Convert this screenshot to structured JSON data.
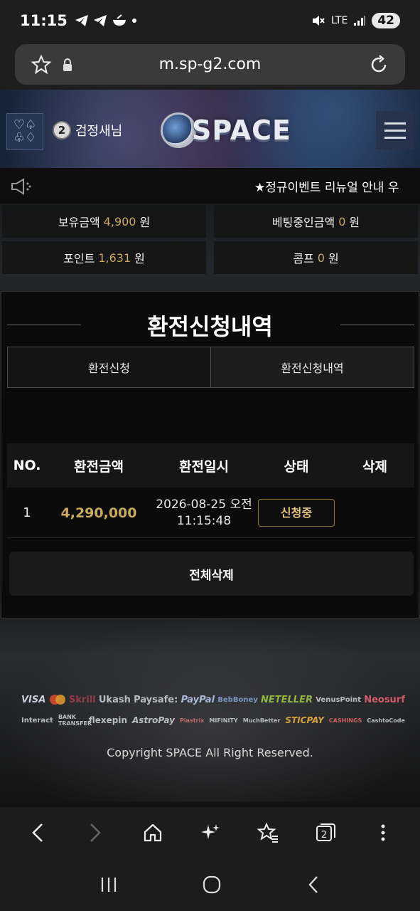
{
  "status_bar": {
    "time": "11:15",
    "network": "LTE",
    "battery": "42"
  },
  "browser": {
    "url": "m.sp-g2.com"
  },
  "header": {
    "user_level": "2",
    "username": "검정새님",
    "logo_text": "SPACE"
  },
  "notice": {
    "text": "★정규이벤트 리뉴얼 안내 우"
  },
  "balances": {
    "holdings_label": "보유금액",
    "holdings_value": "4,900",
    "holdings_unit": "원",
    "betting_label": "베팅중인금액",
    "betting_value": "0",
    "betting_unit": "원",
    "points_label": "포인트",
    "points_value": "1,631",
    "points_unit": "원",
    "comp_label": "콤프",
    "comp_value": "0",
    "comp_unit": "원"
  },
  "panel": {
    "title": "환전신청내역",
    "tabs": [
      "환전신청",
      "환전신청내역"
    ],
    "columns": [
      "NO.",
      "환전금액",
      "환전일시",
      "상태",
      "삭제"
    ],
    "rows": [
      {
        "no": "1",
        "amount": "4,290,000",
        "date_line1": "2026-08-25 오전",
        "date_line2": "11:15:48",
        "status": "신청중"
      }
    ],
    "delete_all": "전체삭제"
  },
  "footer": {
    "payment_row1": [
      "VISA",
      "Skrill",
      "Ukash",
      "Paysafe:",
      "PayPal",
      "BebBoney",
      "NETELLER",
      "VenusPoint",
      "Neosurf"
    ],
    "payment_row2": [
      "Interact",
      "BANK TRANSFER",
      "flexepin",
      "AstroPay",
      "Piastrix",
      "MIFINITY",
      "MuchBetter",
      "STICPAY",
      "CASHINGS",
      "CashtoCode"
    ],
    "copyright": "Copyright SPACE All Right Reserved."
  },
  "colors": {
    "gold": "#c9a85f",
    "status_border": "#8c7440",
    "panel_bg": "#0b0b0b"
  }
}
